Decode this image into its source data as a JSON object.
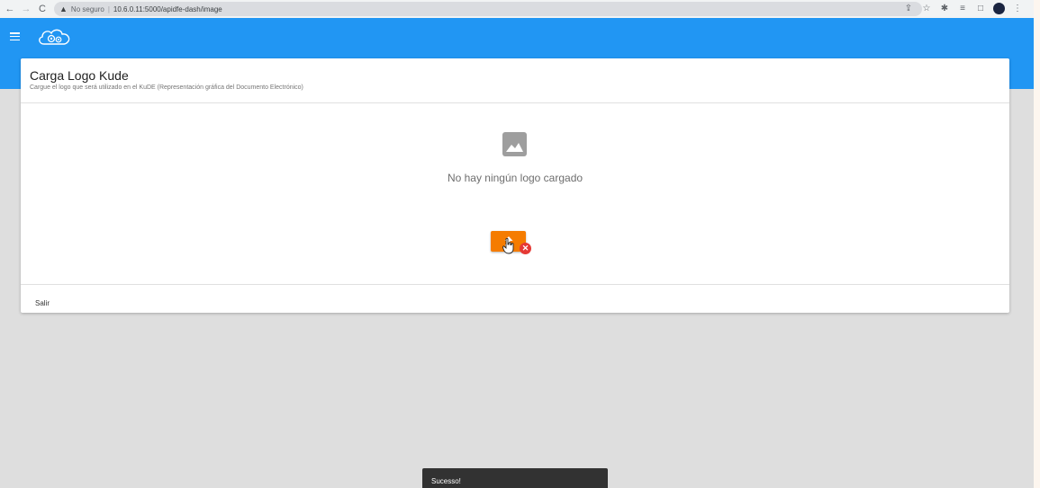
{
  "browser": {
    "security_label": "No seguro",
    "url": "10.6.0.11:5000/apidfe-dash/image"
  },
  "card": {
    "title": "Carga Logo Kude",
    "subtitle": "Cargue el logo que será utilizado en el KuDE (Representación gráfica del Documento Electrónico)",
    "empty_message": "No hay ningún logo cargado",
    "footer_button": "Salir"
  },
  "snackbar": {
    "message": "Sucesso!"
  },
  "colors": {
    "app_bar": "#2196f3",
    "upload_button": "#f57c00",
    "remove_badge": "#e53935",
    "snackbar": "#323232"
  },
  "icons": {
    "menu": "menu-icon",
    "logo": "cloud-gears-logo",
    "placeholder": "image-icon",
    "upload": "upload-arrow-icon",
    "remove": "close-circle-icon"
  }
}
